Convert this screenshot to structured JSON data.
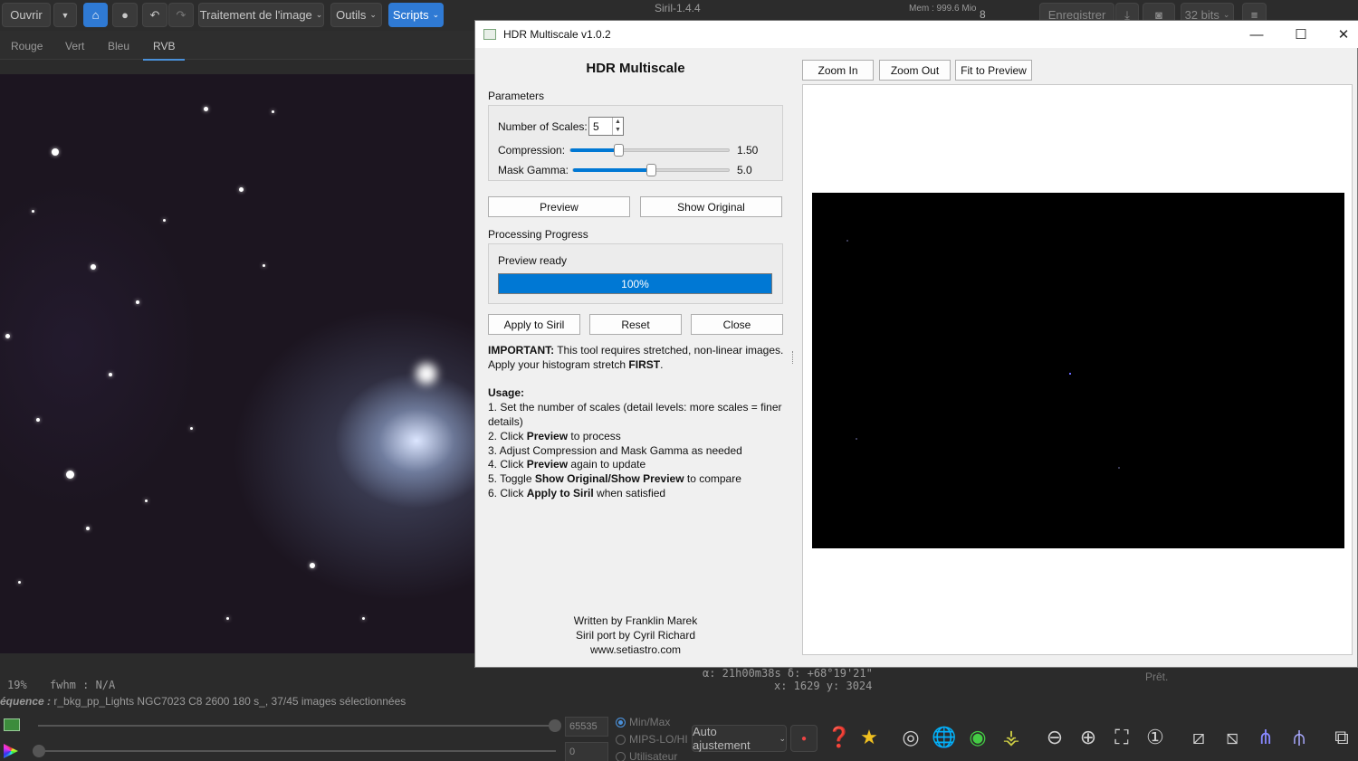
{
  "siril": {
    "app_title": "Siril-1.4.4",
    "header": {
      "open_label": "Ouvrir",
      "image_processing_label": "Traitement de l'image",
      "tools_label": "Outils",
      "scripts_label": "Scripts",
      "memory_label": "Mem : 999.6 Mio",
      "thread_count": "8",
      "save_label": "Enregistrer",
      "bit_depth_label": "32 bits"
    },
    "channel_tabs": [
      "Rouge",
      "Vert",
      "Bleu",
      "RVB"
    ],
    "active_channel_tab": "RVB",
    "info": {
      "zoom": "19%",
      "fwhm": "fwhm : N/A",
      "coords_line1": "α: 21h00m38s  δ: +68°19'21\"",
      "coords_line2": "x: 1629  y: 3024",
      "status": "Prêt."
    },
    "sequence": {
      "prefix": "équence :",
      "text": " r_bkg_pp_Lights NGC7023 C8 2600 180 s_, 37/45 images sélectionnées"
    },
    "display": {
      "max_value": "65535",
      "min_value": "0",
      "modes": [
        "Min/Max",
        "MIPS-LO/HI",
        "Utilisateur"
      ],
      "selected_mode": "Min/Max",
      "stretch_label": "Auto ajustement"
    }
  },
  "dialog": {
    "window_title": "HDR Multiscale v1.0.2",
    "tool_title": "HDR Multiscale",
    "parameters_label": "Parameters",
    "scales_label": "Number of Scales:",
    "scales_value": "5",
    "compression_label": "Compression:",
    "compression_value": "1.50",
    "compression_fraction": 0.3,
    "mask_gamma_label": "Mask Gamma:",
    "mask_gamma_value": "5.0",
    "mask_gamma_fraction": 0.5,
    "preview_button": "Preview",
    "show_original_button": "Show Original",
    "progress_group_label": "Processing Progress",
    "progress_status": "Preview ready",
    "progress_percent": 100,
    "progress_text": "100%",
    "apply_button": "Apply to Siril",
    "reset_button": "Reset",
    "close_button": "Close",
    "important_label": "IMPORTANT:",
    "important_text": " This tool requires stretched, non-linear images. Apply your histogram stretch ",
    "important_first": "FIRST",
    "important_end": ".",
    "usage_label": "Usage:",
    "usage_steps": [
      {
        "pre": "1. Set the number of scales (detail levels: more scales = finer details)",
        "bold": "",
        "post": ""
      },
      {
        "pre": "2. Click ",
        "bold": "Preview",
        "post": " to process"
      },
      {
        "pre": "3. Adjust Compression and Mask Gamma as needed",
        "bold": "",
        "post": ""
      },
      {
        "pre": "4. Click ",
        "bold": "Preview",
        "post": " again to update"
      },
      {
        "pre": "5. Toggle ",
        "bold": "Show Original/Show Preview",
        "post": " to compare"
      },
      {
        "pre": "6. Click ",
        "bold": "Apply to Siril",
        "post": " when satisfied"
      }
    ],
    "credits": [
      "Written by Franklin Marek",
      "Siril port by Cyril Richard",
      "www.setiastro.com"
    ],
    "zoom_in_button": "Zoom In",
    "zoom_out_button": "Zoom Out",
    "fit_button": "Fit to Preview"
  }
}
